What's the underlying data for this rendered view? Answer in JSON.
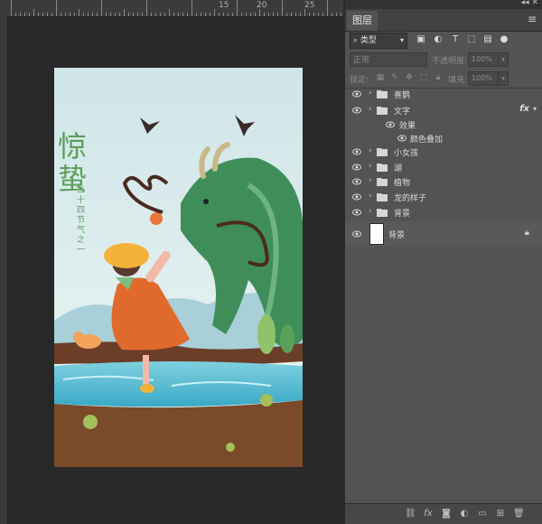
{
  "ruler": {
    "marks": [
      "15",
      "20",
      "25"
    ]
  },
  "document": {
    "title_main": "惊蛰",
    "title_sub": "二十四节气之一",
    "colors": {
      "sky": "#dbecec",
      "dragon": "#3f8e5a",
      "water": "#4fb9d0",
      "ground": "#7a4a2a",
      "dress": "#e06a2c",
      "title": "#5a9e5a"
    }
  },
  "panel": {
    "tab_label": "图层",
    "menu_icon": "hamburger-icon",
    "filter": {
      "label": "类型",
      "icons": [
        "image-filter-icon",
        "adjustment-filter-icon",
        "type-filter-icon",
        "shape-filter-icon",
        "smart-object-filter-icon",
        "filter-toggle-icon"
      ]
    },
    "blend_mode": "正常",
    "opacity": {
      "label": "不透明度:",
      "value": "100%"
    },
    "lock": {
      "label": "锁定:",
      "icons": [
        "lock-transparency-icon",
        "lock-pixels-icon",
        "lock-position-icon",
        "lock-artboard-icon",
        "lock-all-icon"
      ]
    },
    "fill": {
      "label": "填充:",
      "value": "100%"
    },
    "layers": [
      {
        "name": "喜鹊",
        "type": "group"
      },
      {
        "name": "文字",
        "type": "group",
        "fx": "fx"
      },
      {
        "name": "效果",
        "type": "effects"
      },
      {
        "name": "颜色叠加",
        "type": "effect"
      },
      {
        "name": "小女孩",
        "type": "group"
      },
      {
        "name": "湖",
        "type": "group"
      },
      {
        "name": "植物",
        "type": "group"
      },
      {
        "name": "龙的样子",
        "type": "group"
      },
      {
        "name": "背景",
        "type": "group"
      }
    ],
    "background_layer": {
      "name": "背景",
      "locked": true
    },
    "bottom_icons": [
      "link-layers-icon",
      "add-style-icon",
      "add-mask-icon",
      "adjustment-layer-icon",
      "new-group-icon",
      "new-layer-icon",
      "delete-layer-icon"
    ]
  }
}
